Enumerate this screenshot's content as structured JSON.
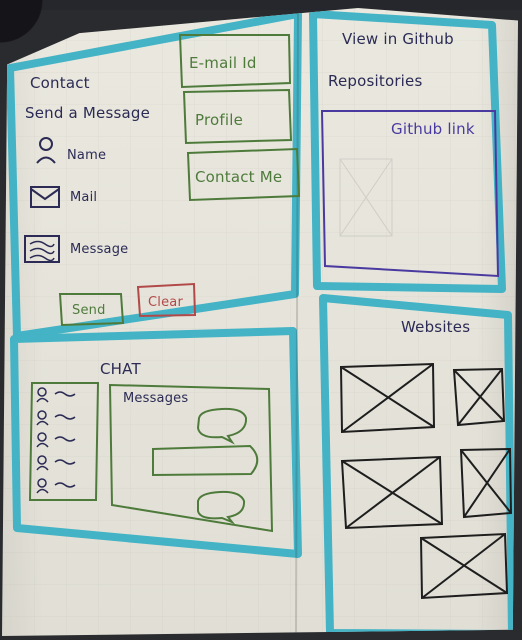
{
  "left_panel": {
    "contact_title": "Contact",
    "send_message": "Send a Message",
    "fields": [
      {
        "label": "Name",
        "icon": "person-icon"
      },
      {
        "label": "Mail",
        "icon": "mail-icon"
      },
      {
        "label": "Message",
        "icon": "message-icon"
      }
    ],
    "buttons": {
      "send": "Send",
      "clear": "Clear"
    }
  },
  "top_nav": [
    {
      "label": "E-mail Id"
    },
    {
      "label": "Profile"
    },
    {
      "label": "Contact Me"
    }
  ],
  "chat": {
    "title": "CHAT",
    "messages_label": "Messages"
  },
  "github_panel": {
    "title": "View in Github",
    "repositories": "Repositories",
    "link": "Github link"
  },
  "websites_panel": {
    "title": "Websites"
  },
  "colors": {
    "teal": "#43b3c5",
    "green": "#4e7b3b",
    "red": "#b24949",
    "purple": "#4a3aa0",
    "ink": "#2b2b55",
    "paper": "#e8e6dc"
  }
}
